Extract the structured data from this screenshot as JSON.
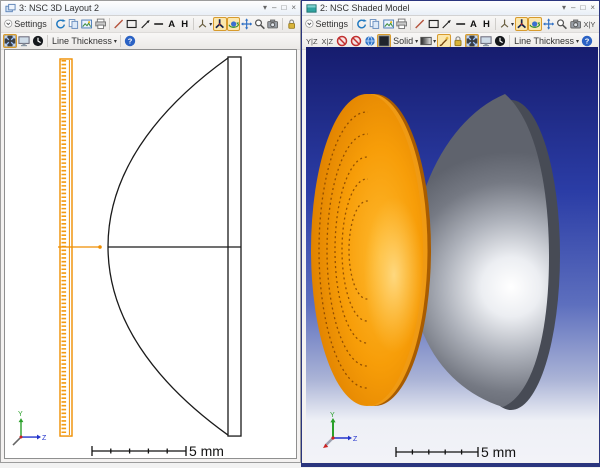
{
  "ui": {
    "caret_glyph": "▾"
  },
  "colors": {
    "highlight_bg": "#fbe7ae",
    "highlight_border": "#d89b2d",
    "active_window_border": "#2a357e",
    "layout_line": "#1a1a1a",
    "fresnel_orange": "#f08a00",
    "viewport_top": "#161c6e",
    "viewport_bottom": "#f2f3f8",
    "shaded_orange": "#f79d08",
    "shaded_gray": "#aeb2bb",
    "axis_y_green": "#2aa02a",
    "axis_z_blue": "#2233cc",
    "axis_x_red": "#cc2222"
  },
  "windows": [
    {
      "title": "3: NSC 3D Layout 2",
      "window_buttons": [
        "▾",
        "–",
        "□",
        "×"
      ],
      "scale_label": "5 mm",
      "axis_y_label": "Y",
      "axis_z_label": "Z",
      "toolbar1": [
        {
          "name": "settings-dropdown",
          "icon": "chevron-circle",
          "label": "Settings"
        },
        {
          "kind": "sep"
        },
        {
          "name": "update-button",
          "icon": "refresh"
        },
        {
          "name": "copy-button",
          "icon": "copy"
        },
        {
          "name": "save-image-button",
          "icon": "save-image"
        },
        {
          "name": "print-button",
          "icon": "print"
        },
        {
          "kind": "sep"
        },
        {
          "name": "draw-line-button",
          "icon": "line-diagonal"
        },
        {
          "name": "draw-rectangle-button",
          "icon": "rectangle"
        },
        {
          "name": "draw-arrow-button",
          "icon": "arrow-line"
        },
        {
          "name": "draw-hline-button",
          "icon": "horizontal-line"
        },
        {
          "name": "annotate-text-button",
          "kind": "text",
          "label": "A",
          "bold": true
        },
        {
          "name": "annotate-h-button",
          "kind": "text",
          "label": "H",
          "bold": true
        },
        {
          "kind": "sep"
        },
        {
          "name": "orientation-dropdown",
          "icon": "axis-3d",
          "caret": true
        },
        {
          "name": "isometric-view-button",
          "icon": "axis-iso",
          "hl": true
        },
        {
          "name": "orbit-button",
          "icon": "orbit",
          "hl": true
        },
        {
          "name": "pan-button",
          "icon": "pan"
        },
        {
          "name": "zoom-button",
          "icon": "magnifier"
        },
        {
          "name": "snapshot-button",
          "icon": "camera"
        },
        {
          "kind": "sep"
        },
        {
          "name": "lock-button",
          "icon": "lock"
        }
      ],
      "toolbar2": [
        {
          "name": "fit-window-button",
          "icon": "fit",
          "hl": true
        },
        {
          "name": "standalone-window-button",
          "icon": "monitor"
        },
        {
          "name": "animate-button",
          "icon": "clock"
        },
        {
          "kind": "sep"
        },
        {
          "name": "line-thickness-dropdown",
          "kind": "text",
          "label": "Line Thickness",
          "caret": true
        },
        {
          "kind": "sep"
        },
        {
          "name": "help-button",
          "icon": "help"
        }
      ]
    },
    {
      "title": "2: NSC Shaded Model",
      "window_buttons": [
        "▾",
        "–",
        "□",
        "×"
      ],
      "scale_label": "5 mm",
      "axis_y_label": "Y",
      "axis_z_label": "Z",
      "toolbar1": [
        {
          "name": "settings-dropdown",
          "icon": "chevron-circle",
          "label": "Settings"
        },
        {
          "kind": "sep"
        },
        {
          "name": "update-button",
          "icon": "refresh"
        },
        {
          "name": "copy-button",
          "icon": "copy"
        },
        {
          "name": "save-image-button",
          "icon": "save-image"
        },
        {
          "name": "print-button",
          "icon": "print"
        },
        {
          "kind": "sep"
        },
        {
          "name": "draw-line-button",
          "icon": "line-diagonal"
        },
        {
          "name": "draw-rectangle-button",
          "icon": "rectangle"
        },
        {
          "name": "draw-arrow-button",
          "icon": "arrow-line"
        },
        {
          "name": "draw-hline-button",
          "icon": "horizontal-line"
        },
        {
          "name": "annotate-text-button",
          "kind": "text",
          "label": "A",
          "bold": true
        },
        {
          "name": "annotate-h-button",
          "kind": "text",
          "label": "H",
          "bold": true
        },
        {
          "kind": "sep"
        },
        {
          "name": "orientation-dropdown",
          "icon": "axis-3d",
          "caret": true
        },
        {
          "name": "isometric-view-button",
          "icon": "axis-iso",
          "hl": true
        },
        {
          "name": "orbit-button",
          "icon": "orbit",
          "hl": true
        },
        {
          "name": "pan-button",
          "icon": "pan"
        },
        {
          "name": "zoom-button",
          "icon": "magnifier"
        },
        {
          "name": "snapshot-button",
          "icon": "camera"
        },
        {
          "name": "view-xy-button",
          "kind": "text",
          "label": "X|Y",
          "small": true
        }
      ],
      "toolbar2": [
        {
          "name": "view-yz-button",
          "kind": "text",
          "label": "Y|Z",
          "small": true
        },
        {
          "name": "view-xz-button",
          "kind": "text",
          "label": "X|Z",
          "small": true
        },
        {
          "name": "hide-rays-button",
          "icon": "ban"
        },
        {
          "name": "hide-sources-button",
          "icon": "ban"
        },
        {
          "name": "globe-button",
          "icon": "globe"
        },
        {
          "name": "background-color-button",
          "icon": "bg-square",
          "hl": true
        },
        {
          "name": "opacity-dropdown",
          "kind": "text",
          "label": "Solid",
          "caret": true
        },
        {
          "name": "color-scheme-dropdown",
          "icon": "gradient-square",
          "caret": true
        },
        {
          "name": "brush-button",
          "icon": "brush",
          "hl": true
        },
        {
          "name": "lock-button",
          "icon": "lock"
        },
        {
          "name": "fit-window-button",
          "icon": "fit",
          "hl": true
        },
        {
          "name": "standalone-window-button",
          "icon": "monitor"
        },
        {
          "name": "animate-button",
          "icon": "clock"
        },
        {
          "kind": "sep"
        },
        {
          "name": "line-thickness-dropdown",
          "kind": "text",
          "label": "Line Thickness",
          "caret": true
        },
        {
          "name": "help-button",
          "icon": "help"
        }
      ]
    }
  ]
}
